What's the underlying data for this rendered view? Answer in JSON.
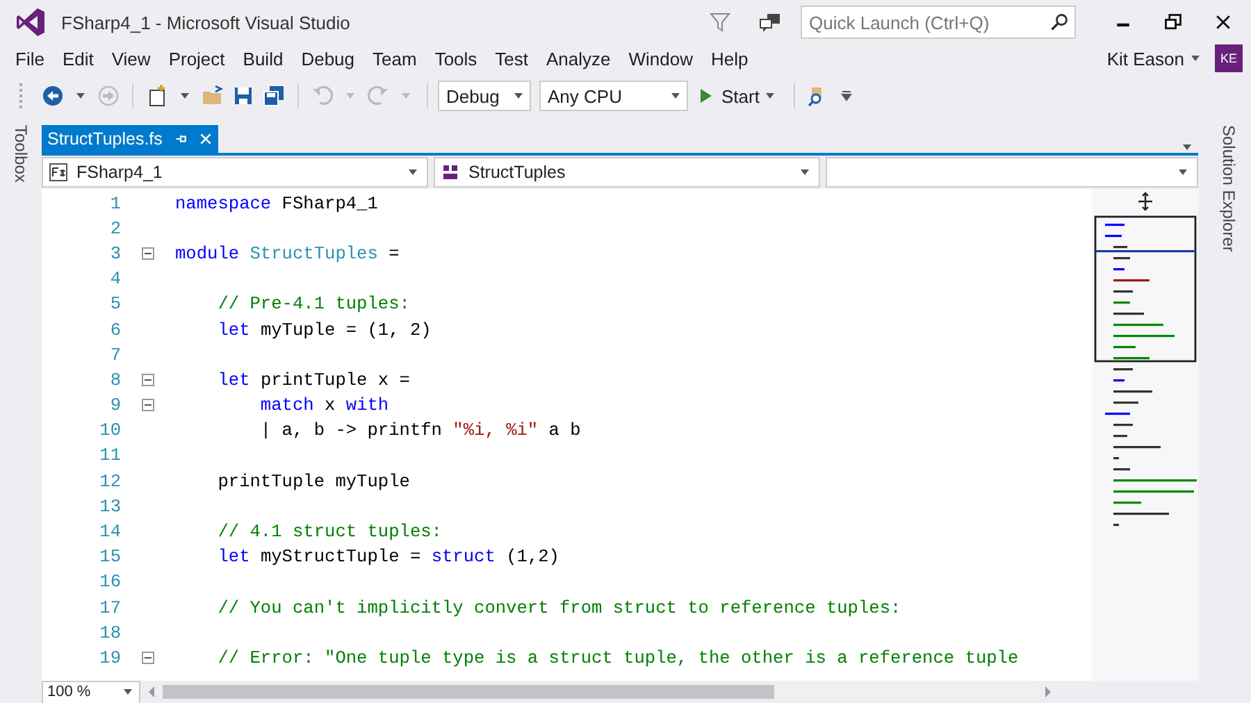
{
  "window": {
    "title": "FSharp4_1 - Microsoft Visual Studio"
  },
  "quick_launch": {
    "placeholder": "Quick Launch (Ctrl+Q)"
  },
  "menu": [
    "File",
    "Edit",
    "View",
    "Project",
    "Build",
    "Debug",
    "Team",
    "Tools",
    "Test",
    "Analyze",
    "Window",
    "Help"
  ],
  "user": {
    "name": "Kit Eason",
    "initials": "KE"
  },
  "toolbar": {
    "configuration": "Debug",
    "platform": "Any CPU",
    "start": "Start"
  },
  "side_panels": {
    "left": "Toolbox",
    "right": "Solution Explorer"
  },
  "tabs": [
    {
      "label": "StructTuples.fs",
      "selected": true
    }
  ],
  "navigation": {
    "project": "FSharp4_1",
    "module": "StructTuples"
  },
  "code": {
    "lines": [
      {
        "number": "1",
        "fold": false,
        "tokens": [
          {
            "kind": "keyword",
            "text": "namespace"
          },
          {
            "kind": "plain",
            "text": " FSharp4_1"
          }
        ]
      },
      {
        "number": "2",
        "fold": false
      },
      {
        "number": "3",
        "fold": true,
        "tokens": [
          {
            "kind": "keyword",
            "text": "module"
          },
          {
            "kind": "type",
            "text": " StructTuples"
          },
          {
            "kind": "plain",
            "text": " ="
          }
        ]
      },
      {
        "number": "4",
        "fold": false
      },
      {
        "number": "5",
        "fold": false,
        "tokens": [
          {
            "kind": "comment",
            "text": "    // Pre-4.1 tuples:"
          }
        ]
      },
      {
        "number": "6",
        "fold": false,
        "tokens": [
          {
            "kind": "keyword",
            "text": "    let"
          },
          {
            "kind": "plain",
            "text": " myTuple = (1, 2)"
          }
        ]
      },
      {
        "number": "7",
        "fold": false
      },
      {
        "number": "8",
        "fold": true,
        "tokens": [
          {
            "kind": "keyword",
            "text": "    let"
          },
          {
            "kind": "plain",
            "text": " printTuple x ="
          }
        ]
      },
      {
        "number": "9",
        "fold": true,
        "tokens": [
          {
            "kind": "keyword",
            "text": "        match"
          },
          {
            "kind": "plain",
            "text": " x "
          },
          {
            "kind": "keyword",
            "text": "with"
          }
        ]
      },
      {
        "number": "10",
        "fold": false,
        "tokens": [
          {
            "kind": "plain",
            "text": "        | a, b -> printfn "
          },
          {
            "kind": "string",
            "text": "\"%i, %i\""
          },
          {
            "kind": "plain",
            "text": " a b"
          }
        ]
      },
      {
        "number": "11",
        "fold": false
      },
      {
        "number": "12",
        "fold": false,
        "tokens": [
          {
            "kind": "plain",
            "text": "    printTuple myTuple"
          }
        ]
      },
      {
        "number": "13",
        "fold": false
      },
      {
        "number": "14",
        "fold": false,
        "tokens": [
          {
            "kind": "comment",
            "text": "    // 4.1 struct tuples:"
          }
        ]
      },
      {
        "number": "15",
        "fold": false,
        "tokens": [
          {
            "kind": "keyword",
            "text": "    let"
          },
          {
            "kind": "plain",
            "text": " myStructTuple = "
          },
          {
            "kind": "keyword",
            "text": "struct"
          },
          {
            "kind": "plain",
            "text": " (1,2)"
          }
        ]
      },
      {
        "number": "16",
        "fold": false
      },
      {
        "number": "17",
        "fold": false,
        "tokens": [
          {
            "kind": "comment",
            "text": "    // You can't implicitly convert from struct to reference tuples:"
          }
        ]
      },
      {
        "number": "18",
        "fold": false
      },
      {
        "number": "19",
        "fold": true,
        "tokens": [
          {
            "kind": "comment",
            "text": "    // Error: \"One tuple type is a struct tuple, the other is a reference tuple"
          }
        ]
      }
    ]
  },
  "zoom": "100 %"
}
